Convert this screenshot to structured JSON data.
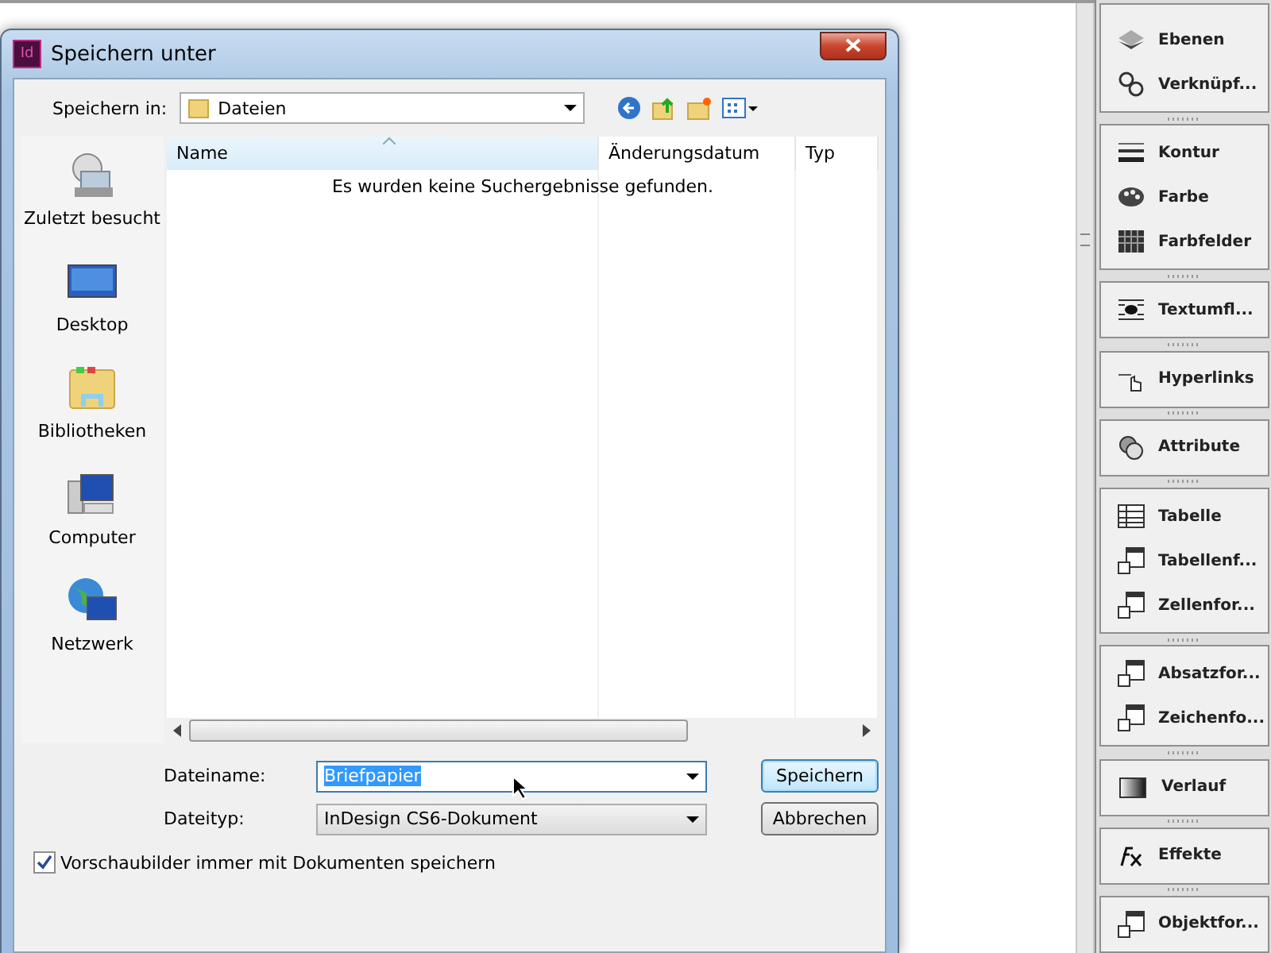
{
  "dialog": {
    "app_icon": "Id",
    "title": "Speichern unter",
    "save_in_label": "Speichern in:",
    "save_in_value": "Dateien",
    "places": [
      {
        "label": "Zuletzt besucht",
        "kind": "recent"
      },
      {
        "label": "Desktop",
        "kind": "desktop"
      },
      {
        "label": "Bibliotheken",
        "kind": "libraries"
      },
      {
        "label": "Computer",
        "kind": "computer"
      },
      {
        "label": "Netzwerk",
        "kind": "network"
      }
    ],
    "columns": [
      {
        "label": "Name",
        "sorted": true
      },
      {
        "label": "Änderungsdatum",
        "sorted": false
      },
      {
        "label": "Typ",
        "sorted": false
      }
    ],
    "empty_message": "Es wurden keine Suchergebnisse gefunden.",
    "filename_label": "Dateiname:",
    "filename_value": "Briefpapier",
    "filename_selected": true,
    "filetype_label": "Dateityp:",
    "filetype_value": "InDesign CS6-Dokument",
    "buttons": [
      {
        "label": "Speichern",
        "default": true
      },
      {
        "label": "Abbrechen",
        "default": false
      }
    ],
    "thumbnail_checkbox": {
      "label": "Vorschaubilder immer mit Dokumenten speichern",
      "checked": true
    }
  },
  "panel_groups": [
    [
      {
        "label": "Ebenen",
        "kind": "layers"
      },
      {
        "label": "Verknüpf...",
        "kind": "links"
      }
    ],
    [
      {
        "label": "Kontur",
        "kind": "stroke"
      },
      {
        "label": "Farbe",
        "kind": "color"
      },
      {
        "label": "Farbfelder",
        "kind": "swatches"
      }
    ],
    [
      {
        "label": "Textumfl...",
        "kind": "wrap"
      }
    ],
    [
      {
        "label": "Hyperlinks",
        "kind": "hyperlinks"
      }
    ],
    [
      {
        "label": "Attribute",
        "kind": "attributes"
      }
    ],
    [
      {
        "label": "Tabelle",
        "kind": "table"
      },
      {
        "label": "Tabellenf...",
        "kind": "tablestyle"
      },
      {
        "label": "Zellenfor...",
        "kind": "cellstyle"
      }
    ],
    [
      {
        "label": "Absatzfor...",
        "kind": "parastyle"
      },
      {
        "label": "Zeichenfo...",
        "kind": "charstyle"
      }
    ],
    [
      {
        "label": "Verlauf",
        "kind": "gradient"
      }
    ],
    [
      {
        "label": "Effekte",
        "kind": "effects"
      }
    ],
    [
      {
        "label": "Objektfor...",
        "kind": "objstyle"
      }
    ]
  ]
}
